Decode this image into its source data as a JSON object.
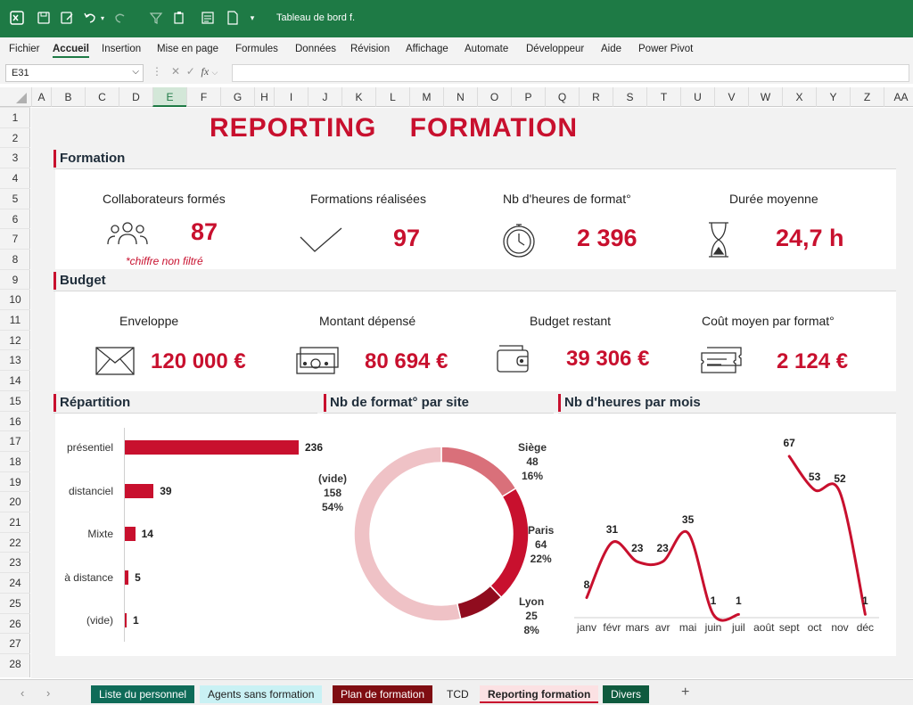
{
  "titlebar": {
    "doc_title": "Tableau de bord f."
  },
  "menu": [
    "Fichier",
    "Accueil",
    "Insertion",
    "Mise en page",
    "Formules",
    "Données",
    "Révision",
    "Affichage",
    "Automate",
    "Développeur",
    "Aide",
    "Power Pivot"
  ],
  "formula": {
    "cell_ref": "E31",
    "fx": "fx"
  },
  "columns": [
    "A",
    "B",
    "C",
    "D",
    "E",
    "F",
    "G",
    "H",
    "I",
    "J",
    "K",
    "L",
    "M",
    "N",
    "O",
    "P",
    "Q",
    "R",
    "S",
    "T",
    "U",
    "V",
    "W",
    "X",
    "Y",
    "Z",
    "AA"
  ],
  "rows": [
    "1",
    "2",
    "3",
    "4",
    "5",
    "6",
    "7",
    "8",
    "9",
    "10",
    "11",
    "12",
    "13",
    "14",
    "15",
    "16",
    "17",
    "18",
    "19",
    "20",
    "21",
    "22",
    "23",
    "24",
    "25",
    "26",
    "27",
    "28"
  ],
  "report": {
    "title": "REPORTING    FORMATION"
  },
  "sections": {
    "formation": "Formation",
    "budget": "Budget",
    "repartition": "Répartition",
    "site": "Nb de format° par site",
    "mois": "Nb d'heures par mois"
  },
  "formation_kpis": [
    {
      "label": "Collaborateurs formés",
      "value": "87",
      "icon": "people-icon"
    },
    {
      "label": "Formations réalisées",
      "value": "97",
      "icon": "checkmark-icon"
    },
    {
      "label": "Nb d'heures de format°",
      "value": "2 396",
      "icon": "stopwatch-icon"
    },
    {
      "label": "Durée moyenne",
      "value": "24,7 h",
      "icon": "hourglass-icon"
    }
  ],
  "formation_note": "*chiffre non filtré",
  "budget_kpis": [
    {
      "label": "Enveloppe",
      "value": "120 000 €",
      "icon": "envelope-icon"
    },
    {
      "label": "Montant dépensé",
      "value": "80 694 €",
      "icon": "banknotes-icon"
    },
    {
      "label": "Budget restant",
      "value": "39 306 €",
      "icon": "wallet-icon"
    },
    {
      "label": "Coût moyen par format°",
      "value": "2 124 €",
      "icon": "ticket-icon"
    }
  ],
  "chart_data": [
    {
      "type": "bar",
      "orientation": "horizontal",
      "categories": [
        "présentiel",
        "distanciel",
        "Mixte",
        "à distance",
        "(vide)"
      ],
      "values": [
        236,
        39,
        14,
        5,
        1
      ],
      "color": "#c8102e"
    },
    {
      "type": "pie",
      "variant": "donut",
      "slices": [
        {
          "label": "Siège",
          "value": 48,
          "pct": "16%",
          "color": "#d9707a"
        },
        {
          "label": "Paris",
          "value": 64,
          "pct": "22%",
          "color": "#c8102e"
        },
        {
          "label": "Lyon",
          "value": 25,
          "pct": "8%",
          "color": "#900c1e"
        },
        {
          "label": "(vide)",
          "value": 158,
          "pct": "54%",
          "color": "#efc2c6"
        }
      ]
    },
    {
      "type": "line",
      "categories": [
        "janv",
        "févr",
        "mars",
        "avr",
        "mai",
        "juin",
        "juil",
        "août",
        "sept",
        "oct",
        "nov",
        "déc"
      ],
      "values": [
        8,
        31,
        23,
        23,
        35,
        1,
        1,
        null,
        67,
        53,
        52,
        1
      ],
      "color": "#c8102e"
    }
  ],
  "sheet_tabs": [
    {
      "label": "Liste du personnel",
      "bg": "#0f6b58",
      "fg": "#ffffff"
    },
    {
      "label": "Agents sans formation",
      "bg": "#c9f1f4",
      "fg": "#222222"
    },
    {
      "label": "Plan de formation",
      "bg": "#7f0d12",
      "fg": "#ffffff"
    },
    {
      "label": "TCD",
      "bg": "#f0f0f0",
      "fg": "#222222"
    },
    {
      "label": "Reporting formation",
      "bg": "#fbe1e3",
      "fg": "#222222"
    },
    {
      "label": "Divers",
      "bg": "#0f5a3e",
      "fg": "#ffffff"
    }
  ],
  "colors": {
    "accent": "#c8102e",
    "excel_green": "#1e7a45"
  }
}
